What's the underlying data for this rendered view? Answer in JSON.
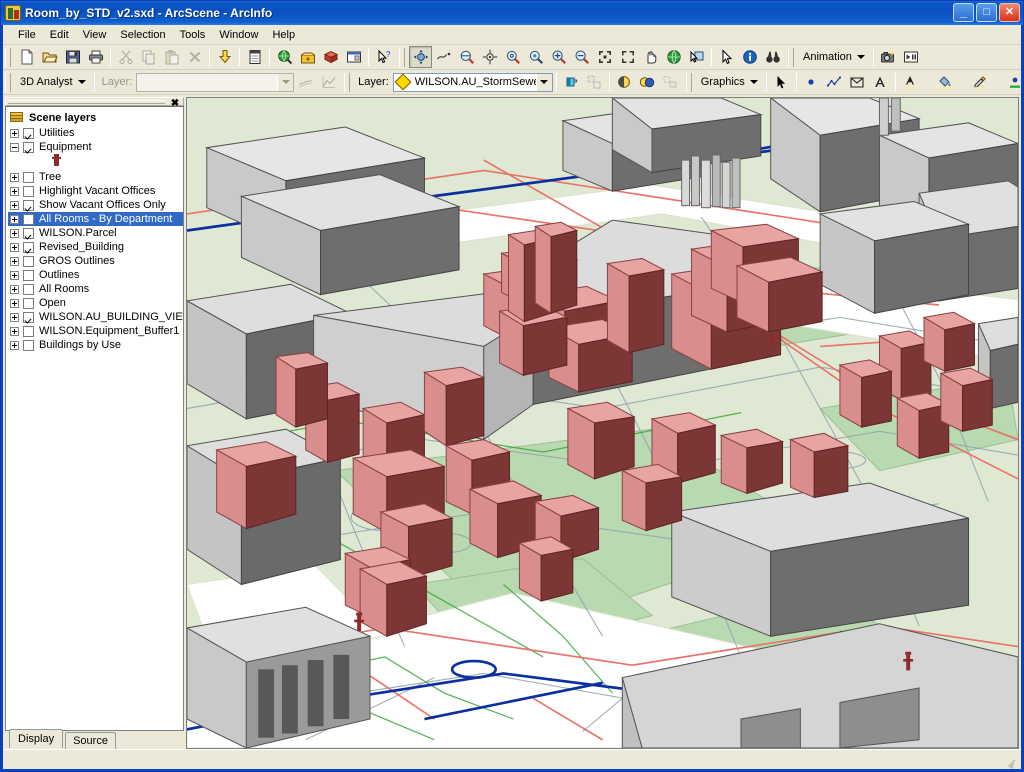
{
  "window": {
    "title": "Room_by_STD_v2.sxd - ArcScene - ArcInfo",
    "app_icon": "arcscene-icon",
    "minimize_label": "_",
    "maximize_label": "□",
    "close_label": "✕"
  },
  "menu": {
    "items": [
      {
        "label": "File"
      },
      {
        "label": "Edit"
      },
      {
        "label": "View"
      },
      {
        "label": "Selection"
      },
      {
        "label": "Tools"
      },
      {
        "label": "Window"
      },
      {
        "label": "Help"
      }
    ]
  },
  "standard_toolbar": {
    "buttons": [
      {
        "name": "new-document-button",
        "icon": "new-document-icon",
        "enabled": true
      },
      {
        "name": "open-document-button",
        "icon": "open-folder-icon",
        "enabled": true
      },
      {
        "name": "save-document-button",
        "icon": "save-disk-icon",
        "enabled": true
      },
      {
        "name": "print-button",
        "icon": "printer-icon",
        "enabled": true
      },
      {
        "name": "cut-button",
        "icon": "scissors-icon",
        "enabled": false
      },
      {
        "name": "copy-button",
        "icon": "copy-icon",
        "enabled": false
      },
      {
        "name": "paste-button",
        "icon": "paste-icon",
        "enabled": false
      },
      {
        "name": "delete-button",
        "icon": "delete-x-icon",
        "enabled": false
      },
      {
        "name": "add-data-button",
        "icon": "add-data-arrow-icon",
        "enabled": true
      },
      {
        "name": "scene-properties-button",
        "icon": "scene-properties-icon",
        "enabled": true
      },
      {
        "name": "arccatalog-button",
        "icon": "globe-magnifier-icon",
        "enabled": true
      },
      {
        "name": "arctoolbox-button",
        "icon": "toolbox-icon",
        "enabled": true
      },
      {
        "name": "model-builder-button",
        "icon": "red-box-icon",
        "enabled": true
      },
      {
        "name": "show-command-line-button",
        "icon": "command-window-icon",
        "enabled": true
      },
      {
        "name": "whats-this-button",
        "icon": "help-pointer-icon",
        "enabled": true
      }
    ]
  },
  "navigation_toolbar": {
    "buttons": [
      {
        "name": "navigate-tool",
        "icon": "navigate-pan-3d-icon",
        "active": true
      },
      {
        "name": "fly-tool",
        "icon": "fly-icon",
        "active": false
      },
      {
        "name": "zoom-in-out-tool",
        "icon": "zoom-in-out-icon",
        "active": false
      },
      {
        "name": "center-on-target-tool",
        "icon": "center-target-icon",
        "active": false
      },
      {
        "name": "zoom-to-target-tool",
        "icon": "zoom-target-icon",
        "active": false
      },
      {
        "name": "set-observer-tool",
        "icon": "set-observer-icon",
        "active": false
      },
      {
        "name": "zoom-in-tool",
        "icon": "magnifier-plus-icon",
        "active": false
      },
      {
        "name": "zoom-out-tool",
        "icon": "magnifier-minus-icon",
        "active": false
      },
      {
        "name": "zoom-in-fixed-button",
        "icon": "zoom-in-fixed-icon",
        "active": false
      },
      {
        "name": "zoom-out-fixed-button",
        "icon": "zoom-out-fixed-icon",
        "active": false
      },
      {
        "name": "pan-tool",
        "icon": "hand-pan-icon",
        "active": false
      },
      {
        "name": "full-extent-button",
        "icon": "globe-full-extent-icon",
        "active": false
      },
      {
        "name": "zoom-to-selection-button",
        "icon": "zoom-selection-icon",
        "active": false
      },
      {
        "name": "select-features-tool",
        "icon": "arrow-select-icon",
        "active": false
      },
      {
        "name": "identify-tool",
        "icon": "info-identify-icon",
        "active": false
      },
      {
        "name": "find-button",
        "icon": "binoculars-find-icon",
        "active": false
      }
    ]
  },
  "animation_toolbar": {
    "menu_label": "Animation",
    "buttons": [
      {
        "name": "capture-view-button",
        "icon": "camera-capture-icon"
      },
      {
        "name": "open-animation-controls-button",
        "icon": "play-controls-icon"
      }
    ]
  },
  "analyst_toolbar": {
    "menu_label": "3D Analyst",
    "layer_label": "Layer:",
    "layer_value": "",
    "layer_placeholder": "",
    "buttons": [
      {
        "name": "interpolate-line-button",
        "icon": "interpolate-line-icon",
        "enabled": false
      },
      {
        "name": "create-profile-graph-button",
        "icon": "profile-graph-icon",
        "enabled": false
      }
    ]
  },
  "editor_toolbar": {
    "layer_label": "Layer:",
    "layer_value": "WILSON.AU_StormSewerLine",
    "layer_icon": "diamond-symbol-icon",
    "buttons": [
      {
        "name": "scene-layer-effects-button",
        "icon": "transparency-icon",
        "enabled": true
      },
      {
        "name": "swipe-button",
        "icon": "swipe-icon",
        "enabled": false
      },
      {
        "name": "shadows-button",
        "icon": "shadow-ball-icon",
        "enabled": true
      },
      {
        "name": "illumination-button",
        "icon": "illumination-icon",
        "enabled": true
      },
      {
        "name": "contrast-button",
        "icon": "contrast-icon",
        "enabled": false
      }
    ]
  },
  "draw_toolbar": {
    "menu_label": "Graphics",
    "buttons": [
      {
        "name": "select-elements-tool",
        "icon": "arrow-select-icon"
      },
      {
        "name": "new-point-tool",
        "icon": "point-marker-icon"
      },
      {
        "name": "new-line-tool",
        "icon": "polyline-icon"
      },
      {
        "name": "new-polygon-tool",
        "icon": "polygon-icon"
      },
      {
        "name": "new-text-tool",
        "icon": "text-a-icon"
      },
      {
        "name": "font-color-button",
        "icon": "font-color-icon"
      },
      {
        "name": "fill-color-button",
        "icon": "fill-color-icon"
      },
      {
        "name": "line-color-button",
        "icon": "line-color-icon"
      },
      {
        "name": "marker-color-button",
        "icon": "marker-color-icon"
      }
    ]
  },
  "toc": {
    "close_label": "✖",
    "header": {
      "label": "Scene layers",
      "icon": "layer-stack-icon"
    },
    "layers": [
      {
        "label": "Utilities",
        "checked": true,
        "expander": "plus",
        "selected": false
      },
      {
        "label": "Equipment",
        "checked": true,
        "expander": "minus",
        "selected": false
      },
      {
        "label": "Tree",
        "checked": false,
        "expander": "plus",
        "selected": false
      },
      {
        "label": "Highlight Vacant Offices",
        "checked": false,
        "expander": "plus",
        "selected": false
      },
      {
        "label": "Show Vacant Offices Only",
        "checked": true,
        "expander": "plus",
        "selected": false
      },
      {
        "label": "All Rooms - By Department",
        "checked": false,
        "expander": "plus",
        "selected": true
      },
      {
        "label": "WILSON.Parcel",
        "checked": true,
        "expander": "plus",
        "selected": false
      },
      {
        "label": "Revised_Building",
        "checked": true,
        "expander": "plus",
        "selected": false
      },
      {
        "label": "GROS Outlines",
        "checked": false,
        "expander": "plus",
        "selected": false
      },
      {
        "label": "Outlines",
        "checked": false,
        "expander": "plus",
        "selected": false
      },
      {
        "label": "All Rooms",
        "checked": false,
        "expander": "plus",
        "selected": false
      },
      {
        "label": "Open",
        "checked": false,
        "expander": "plus",
        "selected": false
      },
      {
        "label": "WILSON.AU_BUILDING_VIEW",
        "checked": true,
        "expander": "plus",
        "selected": false
      },
      {
        "label": "WILSON.Equipment_Buffer1",
        "checked": false,
        "expander": "plus",
        "selected": false
      },
      {
        "label": "Buildings by Use",
        "checked": false,
        "expander": "plus",
        "selected": false
      }
    ],
    "equipment_symbol": "fire-hydrant-symbol",
    "tabs": [
      {
        "label": "Display",
        "active": true
      },
      {
        "label": "Source",
        "active": false
      }
    ]
  },
  "scene": {
    "description": "3D perspective campus scene with extruded grey buildings, pink room-extrusion blocks, green parcel terrain and coloured underground utility lines",
    "colors": {
      "terrain": "#dfe8d2",
      "parcel_green": "#b9d9b0",
      "road": "#ffffff",
      "building_top": "#e6e6e6",
      "building_left": "#c9c9c9",
      "building_right": "#6e6e6e",
      "room_top": "#e8a3a3",
      "room_left": "#d98d8d",
      "room_right": "#7d3636",
      "water_line": "#0b2f9e",
      "sewer_line": "#e8736a",
      "gas_line": "#3aa63a",
      "storm_line": "#8fa3ad",
      "hydrant": "#8b2b2b"
    }
  },
  "statusbar": {
    "text": ""
  }
}
